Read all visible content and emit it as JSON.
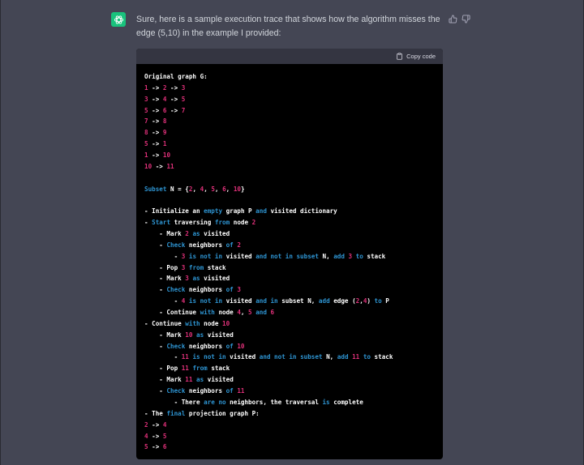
{
  "message": {
    "text": "Sure, here is a sample execution trace that shows how the algorithm misses the edge (5,10) in the example I provided:"
  },
  "code_block": {
    "copy_label": "Copy code",
    "lines": [
      [
        {
          "t": "Original graph G:",
          "c": "w"
        }
      ],
      [
        {
          "t": "1",
          "c": "r"
        },
        {
          "t": " -> ",
          "c": "w"
        },
        {
          "t": "2",
          "c": "r"
        },
        {
          "t": " -> ",
          "c": "w"
        },
        {
          "t": "3",
          "c": "r"
        }
      ],
      [
        {
          "t": "3",
          "c": "r"
        },
        {
          "t": " -> ",
          "c": "w"
        },
        {
          "t": "4",
          "c": "r"
        },
        {
          "t": " -> ",
          "c": "w"
        },
        {
          "t": "5",
          "c": "r"
        }
      ],
      [
        {
          "t": "5",
          "c": "r"
        },
        {
          "t": " -> ",
          "c": "w"
        },
        {
          "t": "6",
          "c": "r"
        },
        {
          "t": " -> ",
          "c": "w"
        },
        {
          "t": "7",
          "c": "r"
        }
      ],
      [
        {
          "t": "7",
          "c": "r"
        },
        {
          "t": " -> ",
          "c": "w"
        },
        {
          "t": "8",
          "c": "r"
        }
      ],
      [
        {
          "t": "8",
          "c": "r"
        },
        {
          "t": " -> ",
          "c": "w"
        },
        {
          "t": "9",
          "c": "r"
        }
      ],
      [
        {
          "t": "5",
          "c": "r"
        },
        {
          "t": " -> ",
          "c": "w"
        },
        {
          "t": "1",
          "c": "r"
        }
      ],
      [
        {
          "t": "1",
          "c": "r"
        },
        {
          "t": " -> ",
          "c": "w"
        },
        {
          "t": "10",
          "c": "r"
        }
      ],
      [
        {
          "t": "10",
          "c": "r"
        },
        {
          "t": " -> ",
          "c": "w"
        },
        {
          "t": "11",
          "c": "r"
        }
      ],
      [],
      [
        {
          "t": "Subset",
          "c": "b"
        },
        {
          "t": " N = {",
          "c": "w"
        },
        {
          "t": "2",
          "c": "r"
        },
        {
          "t": ", ",
          "c": "w"
        },
        {
          "t": "4",
          "c": "r"
        },
        {
          "t": ", ",
          "c": "w"
        },
        {
          "t": "5",
          "c": "r"
        },
        {
          "t": ", ",
          "c": "w"
        },
        {
          "t": "6",
          "c": "r"
        },
        {
          "t": ", ",
          "c": "w"
        },
        {
          "t": "10",
          "c": "r"
        },
        {
          "t": "}",
          "c": "w"
        }
      ],
      [],
      [
        {
          "t": "- Initialize an ",
          "c": "w"
        },
        {
          "t": "empty",
          "c": "b"
        },
        {
          "t": " graph P ",
          "c": "w"
        },
        {
          "t": "and",
          "c": "b"
        },
        {
          "t": " visited dictionary",
          "c": "w"
        }
      ],
      [
        {
          "t": "- ",
          "c": "w"
        },
        {
          "t": "Start",
          "c": "b"
        },
        {
          "t": " traversing ",
          "c": "w"
        },
        {
          "t": "from",
          "c": "b"
        },
        {
          "t": " node ",
          "c": "w"
        },
        {
          "t": "2",
          "c": "r"
        }
      ],
      [
        {
          "t": "    - Mark ",
          "c": "w"
        },
        {
          "t": "2",
          "c": "r"
        },
        {
          "t": " ",
          "c": "w"
        },
        {
          "t": "as",
          "c": "b"
        },
        {
          "t": " visited",
          "c": "w"
        }
      ],
      [
        {
          "t": "    - ",
          "c": "w"
        },
        {
          "t": "Check",
          "c": "b"
        },
        {
          "t": " neighbors ",
          "c": "w"
        },
        {
          "t": "of",
          "c": "b"
        },
        {
          "t": " ",
          "c": "w"
        },
        {
          "t": "2",
          "c": "r"
        }
      ],
      [
        {
          "t": "        - ",
          "c": "w"
        },
        {
          "t": "3",
          "c": "r"
        },
        {
          "t": " ",
          "c": "w"
        },
        {
          "t": "is not in",
          "c": "b"
        },
        {
          "t": " visited ",
          "c": "w"
        },
        {
          "t": "and not in",
          "c": "b"
        },
        {
          "t": " ",
          "c": "w"
        },
        {
          "t": "subset",
          "c": "b"
        },
        {
          "t": " N, ",
          "c": "w"
        },
        {
          "t": "add",
          "c": "b"
        },
        {
          "t": " ",
          "c": "w"
        },
        {
          "t": "3",
          "c": "r"
        },
        {
          "t": " ",
          "c": "w"
        },
        {
          "t": "to",
          "c": "b"
        },
        {
          "t": " stack",
          "c": "w"
        }
      ],
      [
        {
          "t": "    - Pop ",
          "c": "w"
        },
        {
          "t": "3",
          "c": "r"
        },
        {
          "t": " ",
          "c": "w"
        },
        {
          "t": "from",
          "c": "b"
        },
        {
          "t": " stack",
          "c": "w"
        }
      ],
      [
        {
          "t": "    - Mark ",
          "c": "w"
        },
        {
          "t": "3",
          "c": "r"
        },
        {
          "t": " ",
          "c": "w"
        },
        {
          "t": "as",
          "c": "b"
        },
        {
          "t": " visited",
          "c": "w"
        }
      ],
      [
        {
          "t": "    - ",
          "c": "w"
        },
        {
          "t": "Check",
          "c": "b"
        },
        {
          "t": " neighbors ",
          "c": "w"
        },
        {
          "t": "of",
          "c": "b"
        },
        {
          "t": " ",
          "c": "w"
        },
        {
          "t": "3",
          "c": "r"
        }
      ],
      [
        {
          "t": "        - ",
          "c": "w"
        },
        {
          "t": "4",
          "c": "r"
        },
        {
          "t": " ",
          "c": "w"
        },
        {
          "t": "is not in",
          "c": "b"
        },
        {
          "t": " visited ",
          "c": "w"
        },
        {
          "t": "and in",
          "c": "b"
        },
        {
          "t": " subset N, ",
          "c": "w"
        },
        {
          "t": "add",
          "c": "b"
        },
        {
          "t": " edge (",
          "c": "w"
        },
        {
          "t": "2",
          "c": "r"
        },
        {
          "t": ",",
          "c": "w"
        },
        {
          "t": "4",
          "c": "r"
        },
        {
          "t": ") ",
          "c": "w"
        },
        {
          "t": "to",
          "c": "b"
        },
        {
          "t": " P",
          "c": "w"
        }
      ],
      [
        {
          "t": "    - Continue ",
          "c": "w"
        },
        {
          "t": "with",
          "c": "b"
        },
        {
          "t": " node ",
          "c": "w"
        },
        {
          "t": "4",
          "c": "r"
        },
        {
          "t": ", ",
          "c": "w"
        },
        {
          "t": "5",
          "c": "r"
        },
        {
          "t": " ",
          "c": "w"
        },
        {
          "t": "and",
          "c": "b"
        },
        {
          "t": " ",
          "c": "w"
        },
        {
          "t": "6",
          "c": "r"
        }
      ],
      [
        {
          "t": "- Continue ",
          "c": "w"
        },
        {
          "t": "with",
          "c": "b"
        },
        {
          "t": " node ",
          "c": "w"
        },
        {
          "t": "10",
          "c": "r"
        }
      ],
      [
        {
          "t": "    - Mark ",
          "c": "w"
        },
        {
          "t": "10",
          "c": "r"
        },
        {
          "t": " ",
          "c": "w"
        },
        {
          "t": "as",
          "c": "b"
        },
        {
          "t": " visited",
          "c": "w"
        }
      ],
      [
        {
          "t": "    - ",
          "c": "w"
        },
        {
          "t": "Check",
          "c": "b"
        },
        {
          "t": " neighbors ",
          "c": "w"
        },
        {
          "t": "of",
          "c": "b"
        },
        {
          "t": " ",
          "c": "w"
        },
        {
          "t": "10",
          "c": "r"
        }
      ],
      [
        {
          "t": "        - ",
          "c": "w"
        },
        {
          "t": "11",
          "c": "r"
        },
        {
          "t": " ",
          "c": "w"
        },
        {
          "t": "is not in",
          "c": "b"
        },
        {
          "t": " visited ",
          "c": "w"
        },
        {
          "t": "and not in",
          "c": "b"
        },
        {
          "t": " ",
          "c": "w"
        },
        {
          "t": "subset",
          "c": "b"
        },
        {
          "t": " N, ",
          "c": "w"
        },
        {
          "t": "add",
          "c": "b"
        },
        {
          "t": " ",
          "c": "w"
        },
        {
          "t": "11",
          "c": "r"
        },
        {
          "t": " ",
          "c": "w"
        },
        {
          "t": "to",
          "c": "b"
        },
        {
          "t": " stack",
          "c": "w"
        }
      ],
      [
        {
          "t": "    - Pop ",
          "c": "w"
        },
        {
          "t": "11",
          "c": "r"
        },
        {
          "t": " ",
          "c": "w"
        },
        {
          "t": "from",
          "c": "b"
        },
        {
          "t": " stack",
          "c": "w"
        }
      ],
      [
        {
          "t": "    - Mark ",
          "c": "w"
        },
        {
          "t": "11",
          "c": "r"
        },
        {
          "t": " ",
          "c": "w"
        },
        {
          "t": "as",
          "c": "b"
        },
        {
          "t": " visited",
          "c": "w"
        }
      ],
      [
        {
          "t": "    - ",
          "c": "w"
        },
        {
          "t": "Check",
          "c": "b"
        },
        {
          "t": " neighbors ",
          "c": "w"
        },
        {
          "t": "of",
          "c": "b"
        },
        {
          "t": " ",
          "c": "w"
        },
        {
          "t": "11",
          "c": "r"
        }
      ],
      [
        {
          "t": "        - There ",
          "c": "w"
        },
        {
          "t": "are",
          "c": "b"
        },
        {
          "t": " ",
          "c": "w"
        },
        {
          "t": "no",
          "c": "b"
        },
        {
          "t": " neighbors, the traversal ",
          "c": "w"
        },
        {
          "t": "is",
          "c": "b"
        },
        {
          "t": " complete",
          "c": "w"
        }
      ],
      [
        {
          "t": "- The ",
          "c": "w"
        },
        {
          "t": "final",
          "c": "b"
        },
        {
          "t": " projection graph P:",
          "c": "w"
        }
      ],
      [
        {
          "t": "2",
          "c": "r"
        },
        {
          "t": " -> ",
          "c": "w"
        },
        {
          "t": "4",
          "c": "r"
        }
      ],
      [
        {
          "t": "4",
          "c": "r"
        },
        {
          "t": " -> ",
          "c": "w"
        },
        {
          "t": "5",
          "c": "r"
        }
      ],
      [
        {
          "t": "5",
          "c": "r"
        },
        {
          "t": " -> ",
          "c": "w"
        },
        {
          "t": "6",
          "c": "r"
        }
      ]
    ]
  },
  "colors": {
    "page_bg": "#444654",
    "avatar_bg": "#19c37d",
    "code_bg": "#000000",
    "code_header_bg": "#343541",
    "token_red": "#df3079",
    "token_blue": "#2e95d3",
    "token_white": "#ffffff"
  },
  "icons": {
    "avatar": "openai-logo-icon",
    "feedback_up": "thumbs-up-icon",
    "feedback_down": "thumbs-down-icon",
    "copy": "clipboard-icon"
  }
}
